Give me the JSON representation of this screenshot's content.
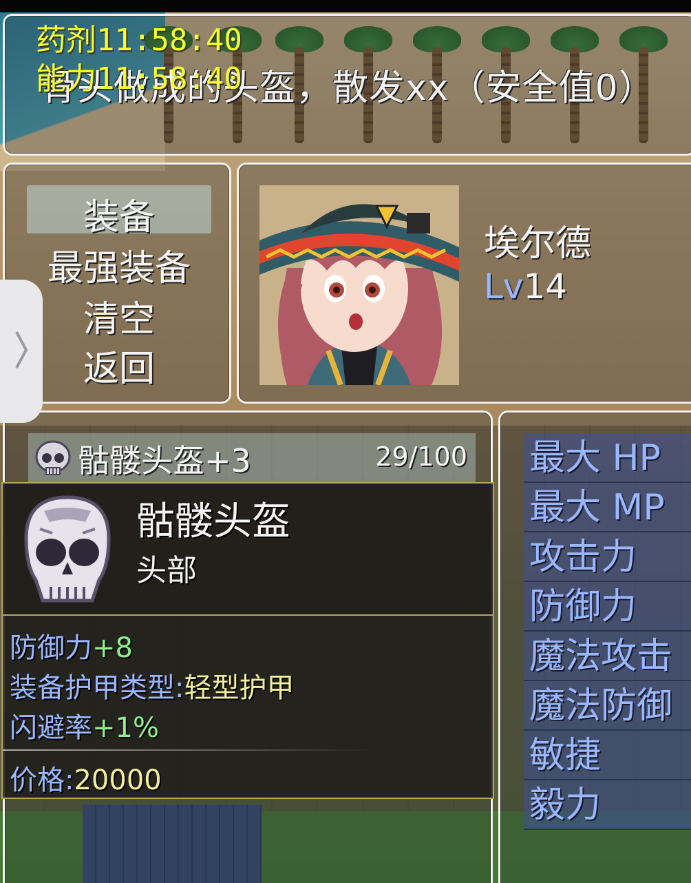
{
  "debug": {
    "line1": "药剂11:58:40",
    "line2": "能力11:58:40"
  },
  "help": {
    "description": "骨头做成的头盔，散发xx（安全值0）"
  },
  "commands": [
    {
      "label": "装备",
      "selected": true
    },
    {
      "label": "最强装备",
      "selected": false
    },
    {
      "label": "清空",
      "selected": false
    },
    {
      "label": "返回",
      "selected": false
    }
  ],
  "actor": {
    "name": "埃尔德",
    "level_label": "Lv",
    "level": "14"
  },
  "slot": {
    "name": "骷髅头盔+3",
    "durability": "29/100",
    "icon": "skull-helmet-icon"
  },
  "item_info": {
    "name": "骷髅头盔",
    "type": "头部",
    "stats": [
      {
        "label": "防御力",
        "value": "+8"
      },
      {
        "label": "装备护甲类型:",
        "value": "轻型护甲"
      },
      {
        "label": "闪避率",
        "value": "+1%"
      }
    ],
    "price_label": "价格:",
    "price": "20000"
  },
  "params": [
    "最大 HP",
    "最大 MP",
    "攻击力",
    "防御力",
    "魔法攻击",
    "魔法防御",
    "敏捷",
    "毅力"
  ],
  "side_tab": {
    "icon": "chevron-right-icon"
  },
  "colors": {
    "window_border": "#f2f2f2",
    "param_text": "#9ab8ff",
    "bonus_green": "#8ef08e",
    "value_yellow": "#f3ef9c",
    "debug_yellow": "#f4ff2c"
  }
}
